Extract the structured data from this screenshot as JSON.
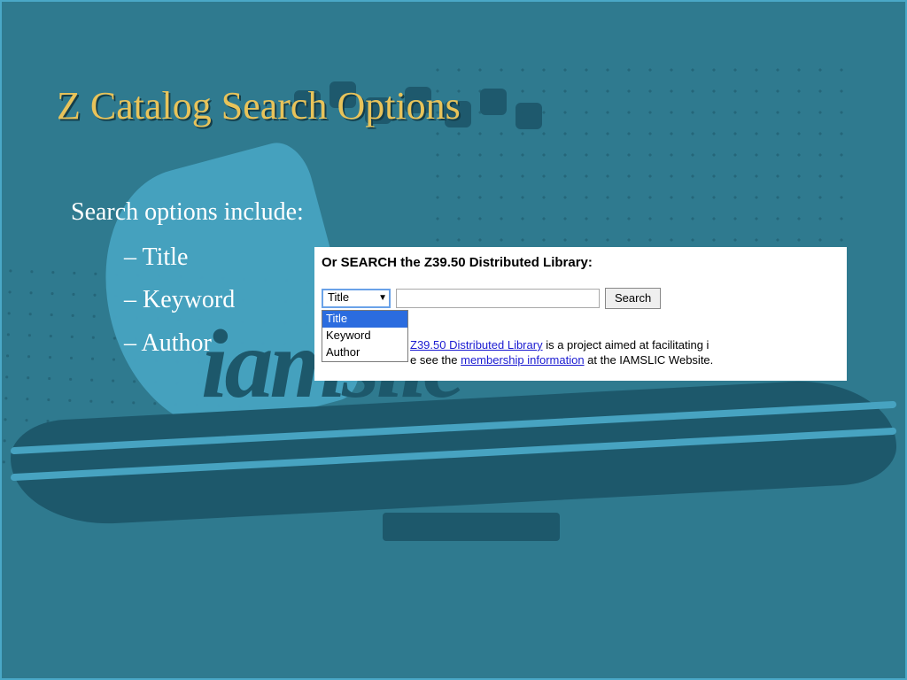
{
  "title": "Z Catalog Search Options",
  "body": {
    "lead": "Search options include:",
    "bullets": [
      "Title",
      "Keyword",
      "Author"
    ]
  },
  "panel": {
    "heading": "Or SEARCH the Z39.50 Distributed Library:",
    "select": {
      "selected": "Title",
      "options": [
        "Title",
        "Keyword",
        "Author"
      ]
    },
    "search_input_value": "",
    "search_button_label": "Search",
    "desc": {
      "link1": "Z39.50 Distributed Library",
      "mid1": " is a project aimed at facilitating i",
      "prefix2": "e see the ",
      "link2": "membership information",
      "suffix2": " at the IAMSLIC Website."
    }
  }
}
